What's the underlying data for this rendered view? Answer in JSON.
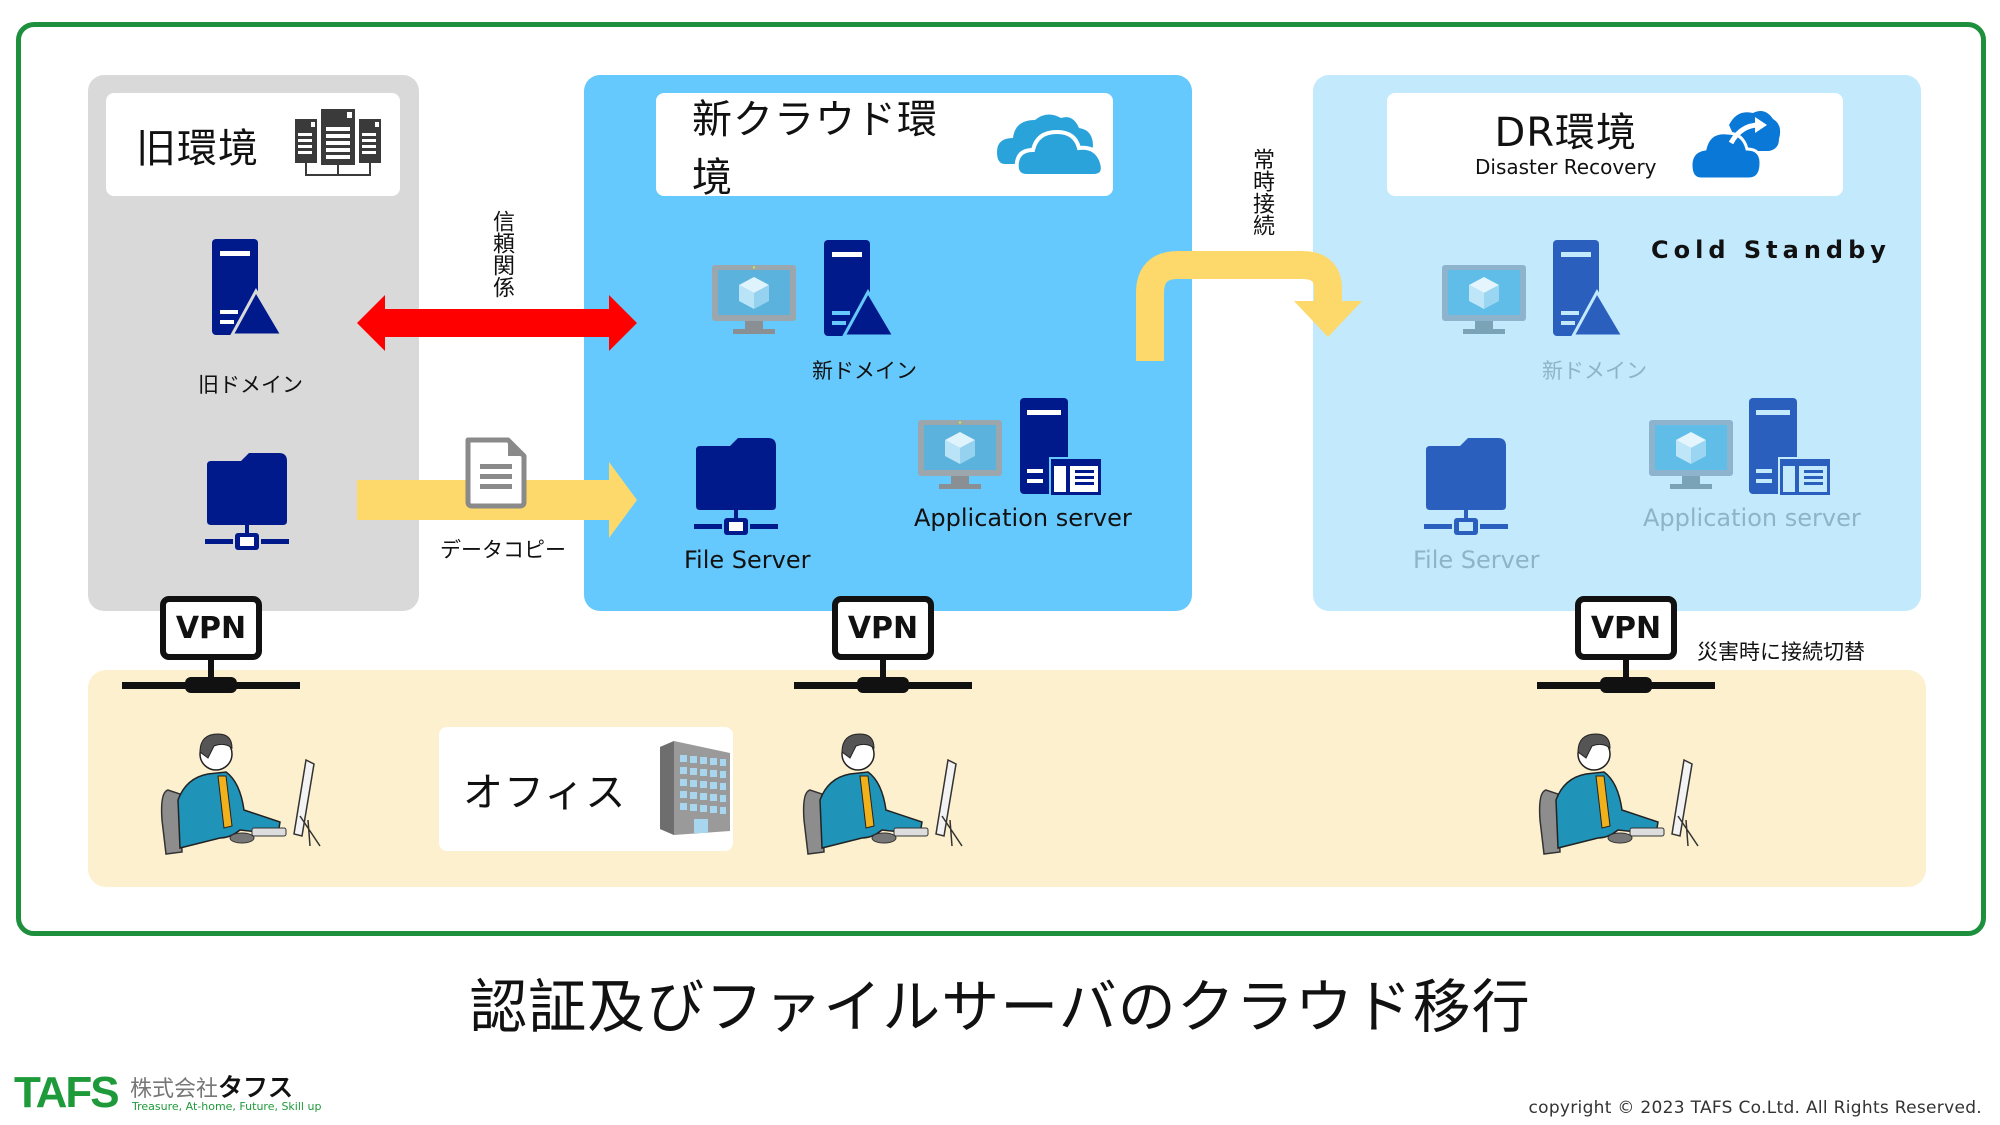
{
  "title": "認証及びファイルサーバのクラウド移行",
  "colors": {
    "frame_border": "#1e8f3c",
    "old_panel": "#d9d9d9",
    "new_panel": "#66c9fd",
    "dr_panel": "#c3e9fc",
    "office_band": "#fdf0cf",
    "trust_arrow": "#ff0000",
    "copy_arrow": "#fdd86a",
    "icon_navy": "#001a8c",
    "icon_dr_blue": "#2a5fbd"
  },
  "old_env": {
    "title": "旧環境",
    "icon": "server-rack-icon",
    "domain_label": "旧ドメイン",
    "domain_icon": "domain-controller-icon",
    "file_icon": "network-folder-icon"
  },
  "new_cloud": {
    "title": "新クラウド環境",
    "icon": "cloud-icon",
    "domain_label": "新ドメイン",
    "file_server_label": "File Server",
    "app_server_label": "Application server"
  },
  "dr_env": {
    "title": "DR環境",
    "subtitle": "Disaster Recovery",
    "icon": "cloud-sync-icon",
    "standby_label": "Cold Standby",
    "domain_label": "新ドメイン",
    "file_server_label": "File Server",
    "app_server_label": "Application server"
  },
  "connectors": {
    "trust_label": "信頼関係",
    "copy_label": "データコピー",
    "always_connected_label": "常時接続",
    "failover_label": "災害時に接続切替"
  },
  "vpn": {
    "label": "VPN",
    "count": 3
  },
  "office": {
    "label": "オフィス",
    "icon": "office-building-icon"
  },
  "footer": {
    "logo_text": "TAFS",
    "company_prefix": "株式会社",
    "company_name": "タフス",
    "tagline": "Treasure, At-home, Future, Skill up",
    "copyright": "copyright © 2023 TAFS Co.Ltd. All Rights Reserved."
  }
}
